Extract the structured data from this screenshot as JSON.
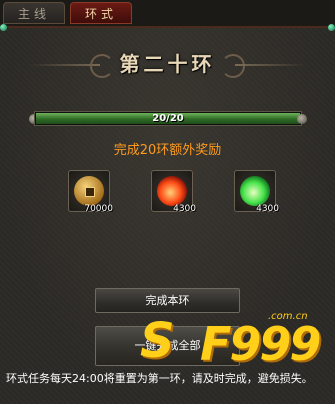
{
  "tabs": [
    {
      "label": "主线",
      "active": false
    },
    {
      "label": "环式",
      "active": true
    }
  ],
  "title": "第二十环",
  "progress": {
    "text": "20/20",
    "current": 20,
    "total": 20
  },
  "reward_title": "完成20环额外奖励",
  "rewards": [
    {
      "icon": "gold-coin-icon",
      "qty": "70000"
    },
    {
      "icon": "red-flame-orb-icon",
      "qty": "4300"
    },
    {
      "icon": "green-flame-orb-icon",
      "qty": "4300"
    }
  ],
  "buttons": {
    "complete_ring": "完成本环",
    "one_click": "一键完成全部"
  },
  "watermark": {
    "brand": "SF999",
    "domain": ".com.cn"
  },
  "footer": "环式任务每天24:00将重置为第一环，请及时完成，避免损失。",
  "colors": {
    "progress_fill": "#3f8a33",
    "reward_title": "#ff9a1e",
    "active_tab": "#6b1a14"
  }
}
